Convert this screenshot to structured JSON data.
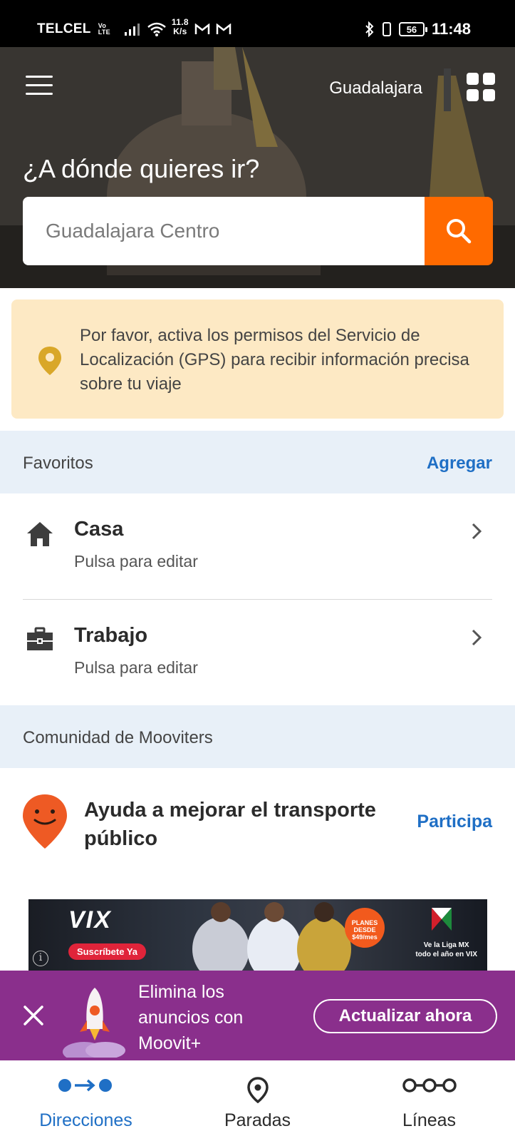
{
  "status_bar": {
    "carrier": "TELCEL",
    "volte_top": "Vo",
    "volte_bottom": "LTE",
    "speed_value": "11.8",
    "speed_unit": "K/s",
    "battery": "56",
    "time": "11:48"
  },
  "header": {
    "city": "Guadalajara",
    "title": "¿A dónde quieres ir?",
    "search_placeholder": "Guadalajara Centro"
  },
  "gps_banner": {
    "text": "Por favor, activa los permisos del Servicio de Localización (GPS) para recibir información precisa sobre tu viaje"
  },
  "favorites": {
    "title": "Favoritos",
    "action": "Agregar",
    "items": [
      {
        "name": "Casa",
        "subtitle": "Pulsa para editar",
        "icon": "home-icon"
      },
      {
        "name": "Trabajo",
        "subtitle": "Pulsa para editar",
        "icon": "briefcase-icon"
      }
    ]
  },
  "community": {
    "title": "Comunidad de Mooviters",
    "text": "Ayuda a mejorar el transporte público",
    "action": "Participa"
  },
  "ad": {
    "brand": "VIX",
    "cta": "Suscríbete Ya",
    "badge": "PLANES DESDE $49/mes",
    "claim_line1": "Ve la Liga MX",
    "claim_line2": "todo el año en VIX",
    "info": "i"
  },
  "upsell": {
    "line1": "Elimina los",
    "line2": "anuncios con",
    "line3": "Moovit+",
    "button": "Actualizar ahora"
  },
  "bottom_nav": {
    "items": [
      {
        "label": "Direcciones",
        "active": true
      },
      {
        "label": "Paradas",
        "active": false
      },
      {
        "label": "Líneas",
        "active": false
      }
    ]
  },
  "colors": {
    "accent_orange": "#ff6a00",
    "link_blue": "#1f6fc5",
    "upsell_purple": "#8a2f8c",
    "gps_banner_bg": "#fde9c4",
    "section_header_bg": "#e8f0f8"
  }
}
